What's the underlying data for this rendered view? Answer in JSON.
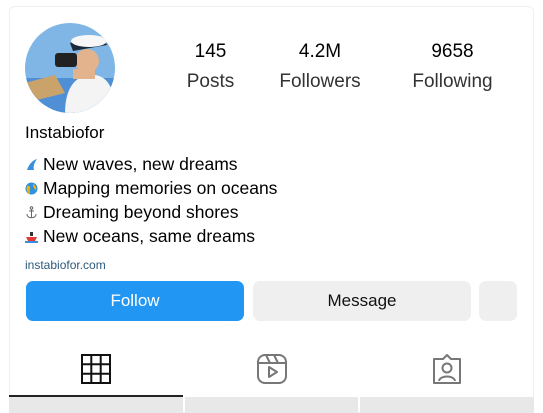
{
  "profile": {
    "stats": [
      {
        "value": "145",
        "label": "Posts"
      },
      {
        "value": "4.2M",
        "label": "Followers"
      },
      {
        "value": "9658",
        "label": "Following"
      }
    ],
    "username": "Instabiofor",
    "bio_lines": [
      {
        "icon": "surf-wave-icon",
        "text": "New waves, new dreams"
      },
      {
        "icon": "globe-icon",
        "text": "Mapping memories on oceans"
      },
      {
        "icon": "anchor-icon",
        "text": "Dreaming beyond shores"
      },
      {
        "icon": "ship-icon",
        "text": "New oceans, same dreams"
      }
    ],
    "link": "instabiofor.com"
  },
  "actions": {
    "follow": "Follow",
    "message": "Message"
  },
  "tabs": [
    {
      "icon": "grid-icon",
      "active": true
    },
    {
      "icon": "reels-icon",
      "active": false
    },
    {
      "icon": "tagged-icon",
      "active": false
    }
  ],
  "colors": {
    "follow_button": "#2196f3",
    "secondary_button": "#efefef",
    "link": "#2c5a7c"
  }
}
